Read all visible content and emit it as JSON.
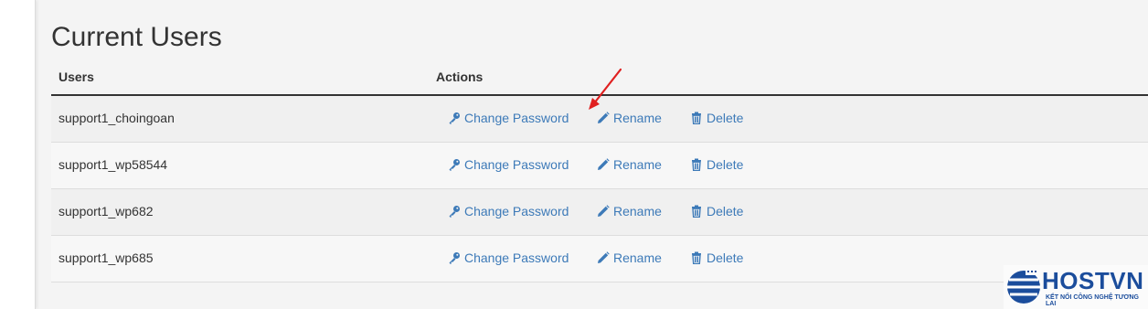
{
  "page": {
    "title": "Current Users"
  },
  "table": {
    "headers": {
      "users": "Users",
      "actions": "Actions"
    },
    "rows": [
      {
        "user": "support1_choingoan"
      },
      {
        "user": "support1_wp58544"
      },
      {
        "user": "support1_wp682"
      },
      {
        "user": "support1_wp685"
      }
    ],
    "actions": {
      "change_password": "Change Password",
      "rename": "Rename",
      "delete": "Delete"
    }
  },
  "logo": {
    "name": "HOSTVN",
    "tagline": "KẾT NỐI CÔNG NGHỆ TƯƠNG LAI"
  },
  "colors": {
    "link": "#3d7ab8",
    "annotation_arrow": "#e02020",
    "brand": "#1b4d9c"
  },
  "icons": {
    "change_password": "key-icon",
    "rename": "pencil-icon",
    "delete": "trash-icon"
  }
}
